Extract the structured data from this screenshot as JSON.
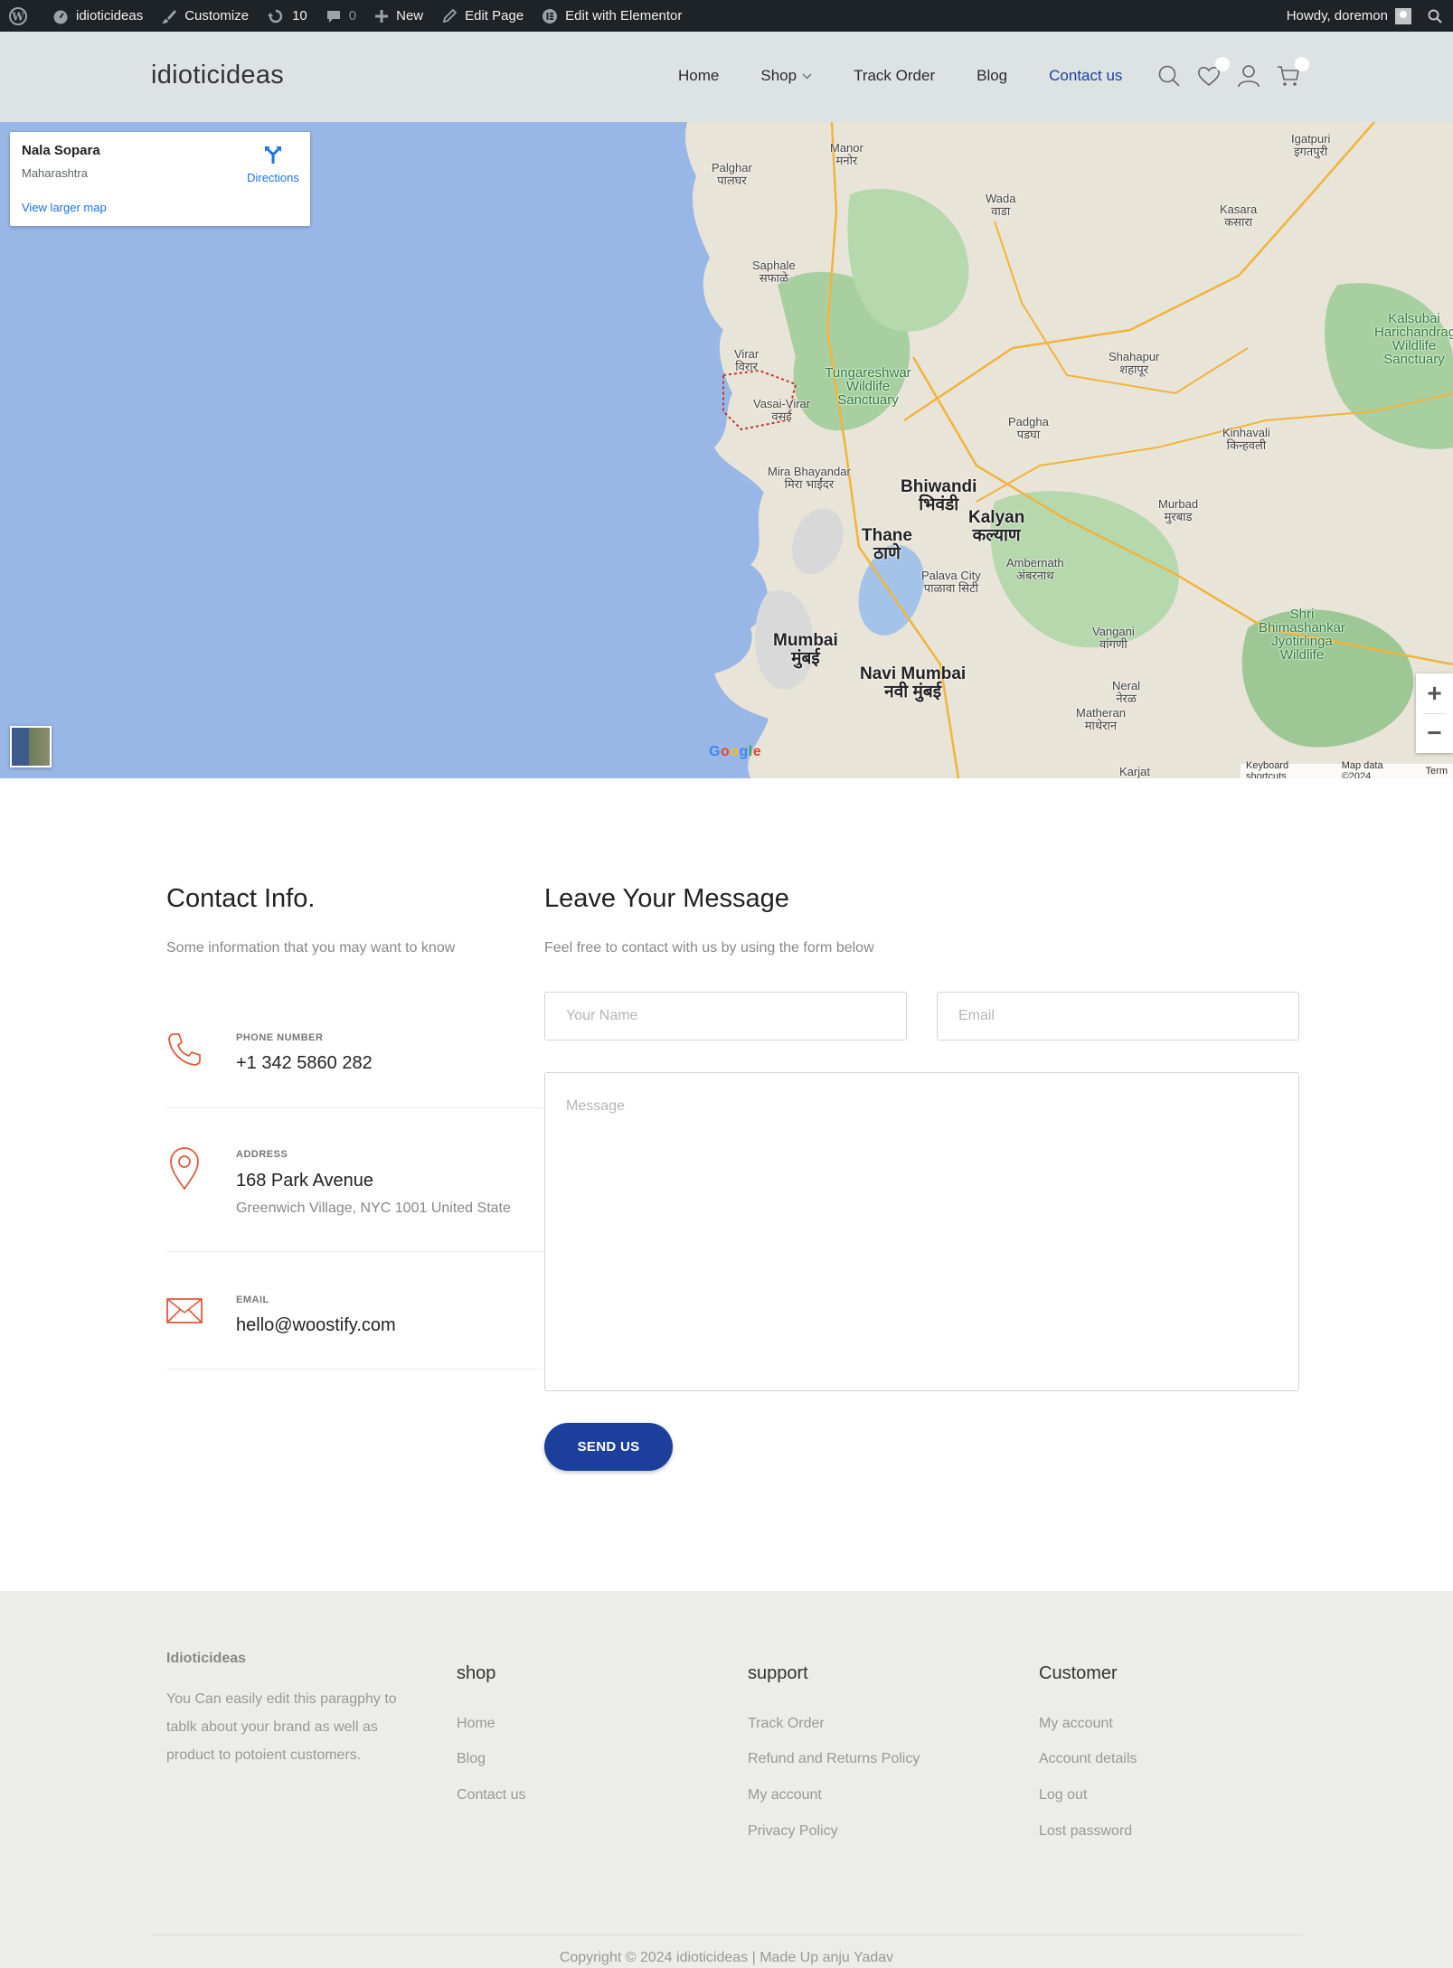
{
  "adminbar": {
    "site_name": "idioticideas",
    "customize": "Customize",
    "updates_count": "10",
    "comments_count": "0",
    "new": "New",
    "edit_page": "Edit Page",
    "edit_elementor": "Edit with Elementor",
    "howdy": "Howdy, doremon"
  },
  "header": {
    "logo": "idioticideas",
    "nav": {
      "home": "Home",
      "shop": "Shop",
      "track_order": "Track Order",
      "blog": "Blog",
      "contact": "Contact us"
    }
  },
  "map": {
    "place_title": "Nala Sopara",
    "place_region": "Maharashtra",
    "directions": "Directions",
    "larger_map": "View larger map",
    "google": "Google",
    "keyboard_shortcuts": "Keyboard shortcuts",
    "map_data": "Map data ©2024",
    "terms": "Term",
    "labels": {
      "mumbai": "Mumbai",
      "mumbai_dev": "मुंबई",
      "navi_mumbai": "Navi Mumbai",
      "navi_mumbai_dev": "नवी मुंबई",
      "thane": "Thane",
      "thane_dev": "ठाणे",
      "bhiwandi": "Bhiwandi",
      "bhiwandi_dev": "भिवंडी",
      "kalyan": "Kalyan",
      "kalyan_dev": "कल्याण",
      "vasai": "Vasai-Virar",
      "vasai_dev": "वसई",
      "virar": "Virar",
      "virar_dev": "विरार",
      "palghar": "Palghar",
      "palghar_dev": "पालघर",
      "manor": "Manor",
      "manor_dev": "मनोर",
      "wada": "Wada",
      "wada_dev": "वाडा",
      "saphale": "Saphale",
      "saphale_dev": "सफाळे",
      "tungareshwar": "Tungareshwar Wildlife Sanctuary",
      "mira": "Mira Bhayandar",
      "mira_dev": "मिरा भाईंदर",
      "padgha": "Padgha",
      "padgha_dev": "पडघा",
      "shahapur": "Shahapur",
      "shahapur_dev": "शहापूर",
      "igatpuri": "Igatpuri",
      "igatpuri_dev": "इगतपुरी",
      "kasara": "Kasara",
      "kasara_dev": "कसारा",
      "murbad": "Murbad",
      "murbad_dev": "मुरबाड",
      "ambernath": "Ambernath",
      "ambernath_dev": "अंबरनाथ",
      "palava": "Palava City",
      "palava_dev": "पाळावा सिटी",
      "kinhavali": "Kinhavali",
      "kinhavali_dev": "किन्हवली",
      "vangani": "Vangani",
      "vangani_dev": "वांगणी",
      "neral": "Neral",
      "neral_dev": "नेरळ",
      "matheran": "Matheran",
      "matheran_dev": "माथेरान",
      "karjat": "Karjat",
      "bhimashankar": "Shri Bhimashankar Jyotirlinga Wildlife",
      "kalsubai": "Kalsubai Harichandragad Wildlife Sanctuary"
    }
  },
  "contact": {
    "title": "Contact Info.",
    "subtitle": "Some information that you may want to know",
    "phone_label": "PHONE NUMBER",
    "phone": "+1 342 5860 282",
    "address_label": "ADDRESS",
    "address": "168 Park Avenue",
    "address_extra": "Greenwich Village, NYC 1001 United State",
    "email_label": "EMAIL",
    "email": "hello@woostify.com"
  },
  "message": {
    "title": "Leave Your Message",
    "subtitle": "Feel free to contact with us by using the form below",
    "name_placeholder": "Your Name",
    "email_placeholder": "Email",
    "message_placeholder": "Message",
    "send": "SEND US"
  },
  "footer": {
    "brand_title": "Idioticideas",
    "brand_text": "You Can easily edit this paragphy to tablk about your brand as well as product to potoient customers.",
    "shop_head": "shop",
    "shop_links": [
      "Home",
      "Blog",
      "Contact us"
    ],
    "support_head": "support",
    "support_links": [
      "Track Order",
      "Refund and Returns Policy",
      "My account",
      "Privacy Policy"
    ],
    "customer_head": "Customer",
    "customer_links": [
      "My account",
      "Account details",
      "Log out",
      "Lost password"
    ],
    "copyright": "Copyright © 2024 idioticideas | Made Up anju Yadav"
  },
  "colors": {
    "primary": "#1c3f9c",
    "accent_icon": "#e05a3a",
    "header_bg": "#dde3e3",
    "footer_bg": "#ececeb"
  }
}
